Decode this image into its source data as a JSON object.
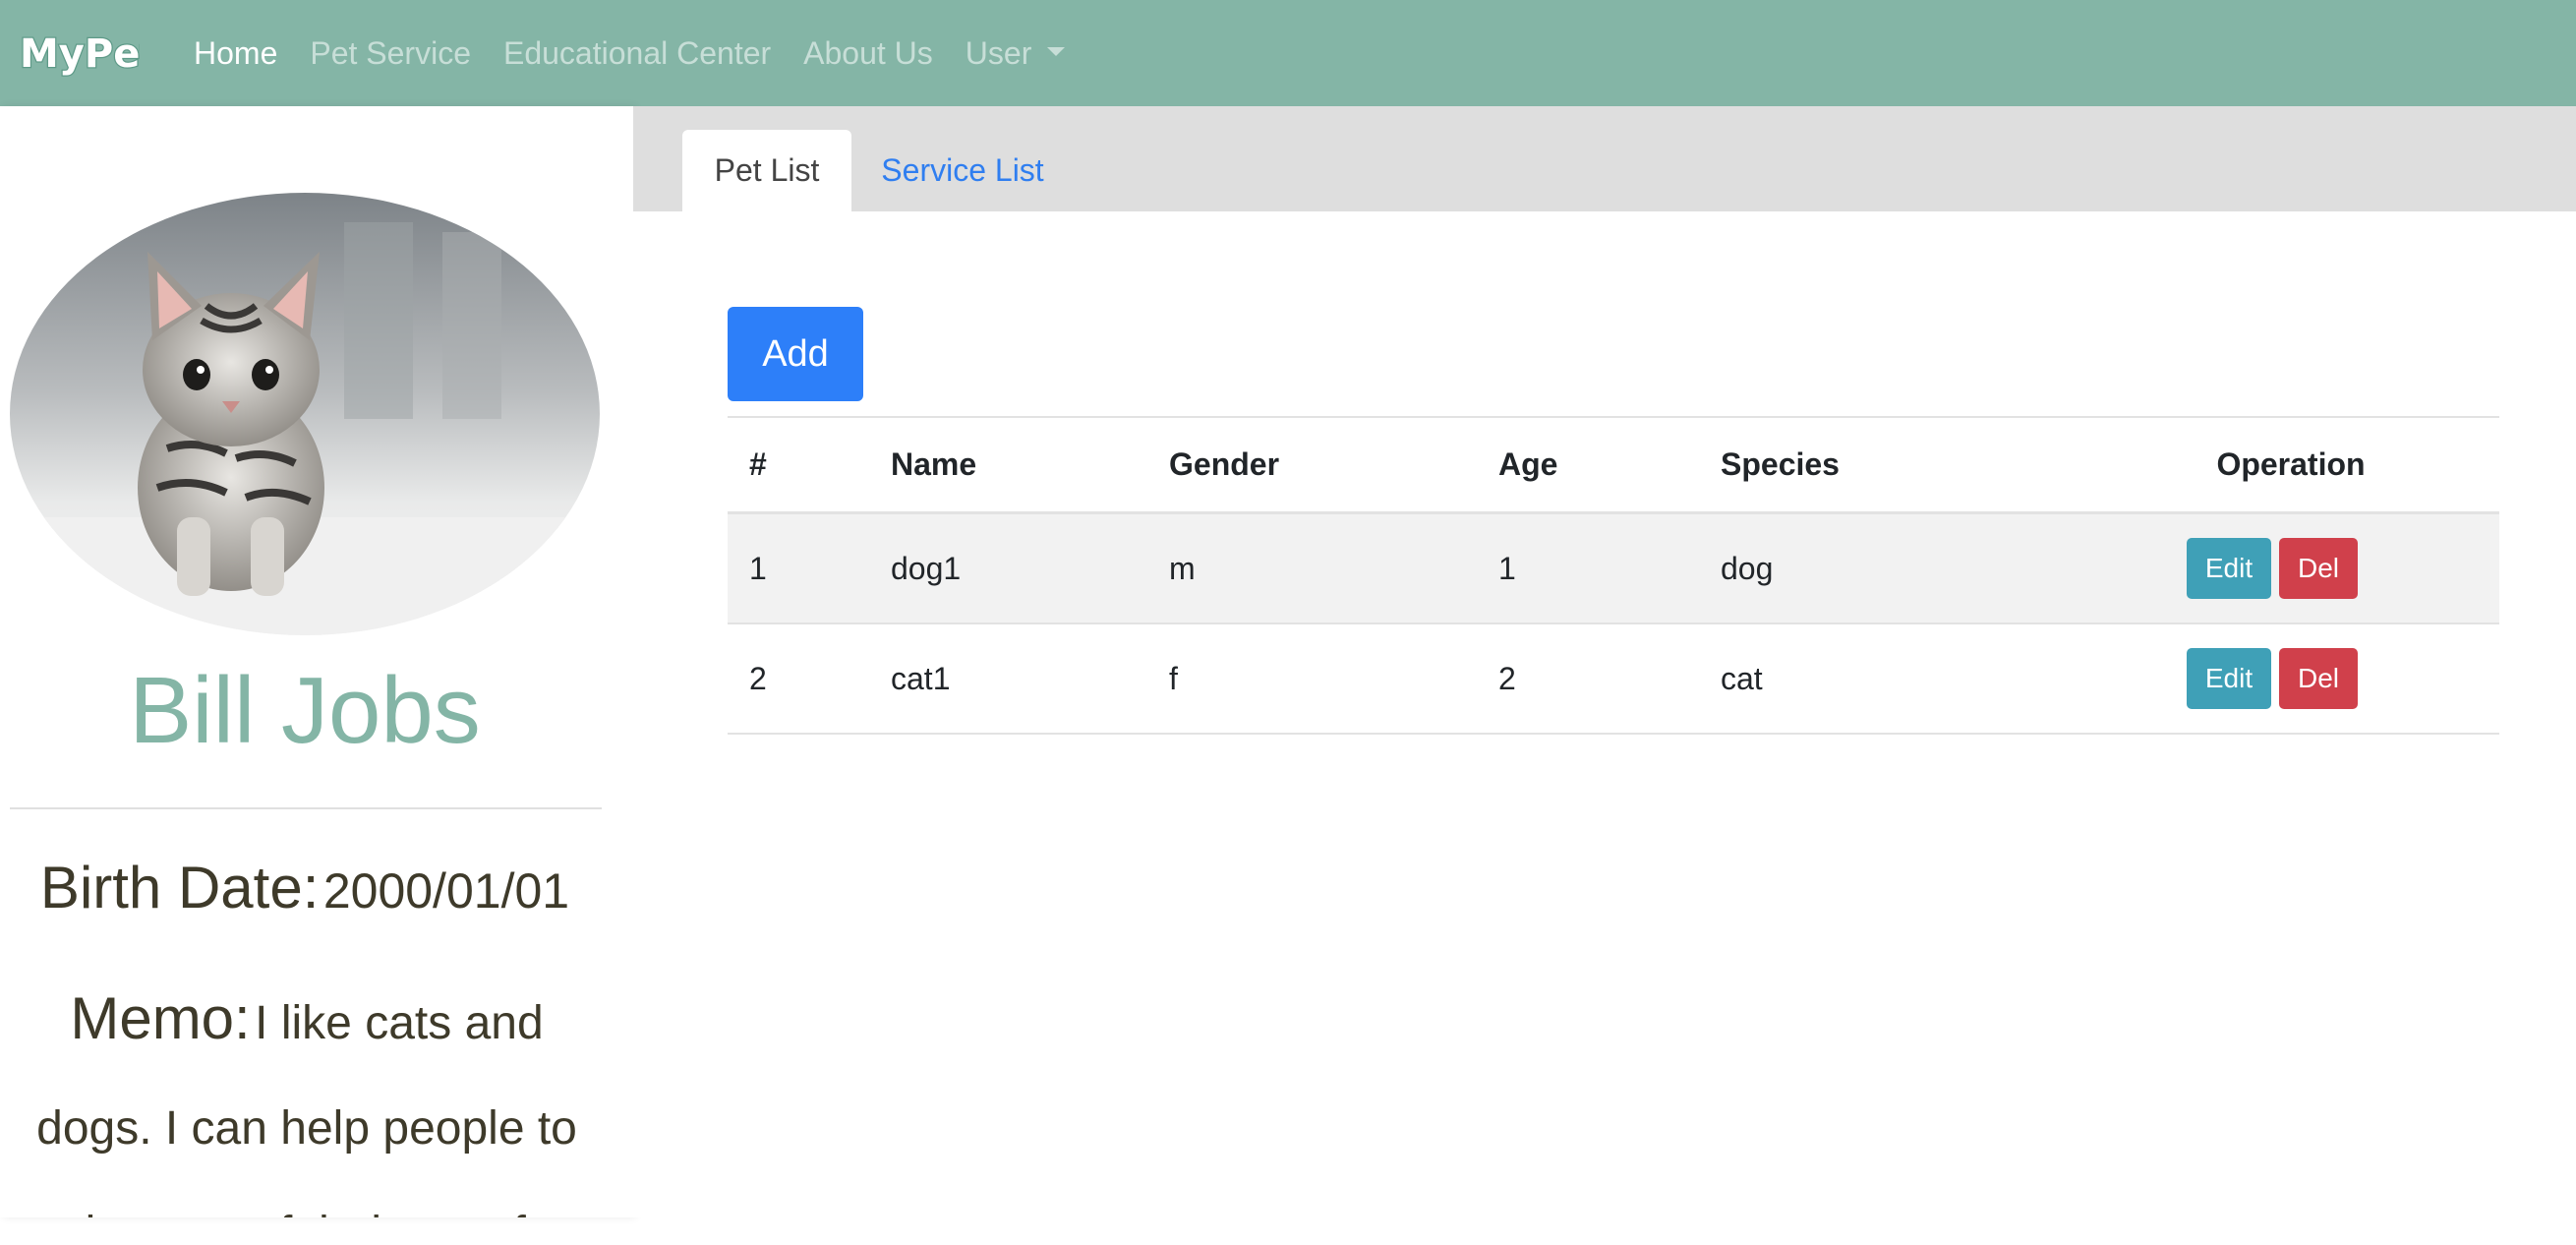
{
  "nav": {
    "brand": "MyPet",
    "links": [
      "Home",
      "Pet Service",
      "Educational Center",
      "About Us",
      "User"
    ],
    "active": "Home"
  },
  "profile": {
    "name": "Bill Jobs",
    "birth_label": "Birth Date:",
    "birth_value": "2000/01/01",
    "memo_label": "Memo:",
    "memo_value": "I like cats and dogs. I can help people to take care of their pets for"
  },
  "tabs": [
    {
      "label": "Pet List",
      "active": true
    },
    {
      "label": "Service List",
      "active": false
    }
  ],
  "add_label": "Add",
  "table": {
    "headers": [
      "#",
      "Name",
      "Gender",
      "Age",
      "Species",
      "Operation"
    ],
    "rows": [
      {
        "id": "1",
        "name": "dog1",
        "gender": "m",
        "age": "1",
        "species": "dog"
      },
      {
        "id": "2",
        "name": "cat1",
        "gender": "f",
        "age": "2",
        "species": "cat"
      }
    ],
    "edit_label": "Edit",
    "del_label": "Del"
  },
  "colors": {
    "navbar": "#84b5a6",
    "accent": "#84b5a6",
    "primary": "#2d7ff9",
    "info": "#3fa0b7",
    "danger": "#d0404b"
  }
}
